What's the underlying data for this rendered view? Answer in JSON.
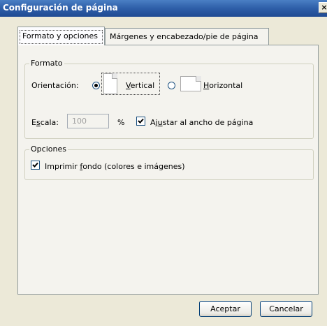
{
  "window": {
    "title": "Configuración de página",
    "close_glyph": "×"
  },
  "tabs": [
    {
      "label": "Formato y opciones",
      "active": true
    },
    {
      "label": "Márgenes y encabezado/pie de página",
      "active": false
    }
  ],
  "format_group": {
    "legend": "Formato",
    "orientation_label": "Orientación:",
    "orientation_options": [
      {
        "mnemonic": "V",
        "rest": "ertical",
        "selected": true
      },
      {
        "mnemonic": "H",
        "rest": "orizontal",
        "selected": false
      }
    ],
    "scale": {
      "label_pre": "E",
      "label_mnemonic": "s",
      "label_post": "cala:",
      "value": "100",
      "unit": "%"
    },
    "fit_width": {
      "checked": true,
      "pre": "Aj",
      "mnemonic": "u",
      "post": "star al ancho de página"
    }
  },
  "options_group": {
    "legend": "Opciones",
    "print_background": {
      "checked": true,
      "pre": "Imprimir ",
      "mnemonic": "f",
      "post": "ondo (colores e imágenes)"
    }
  },
  "buttons": {
    "accept": "Aceptar",
    "cancel": "Cancelar"
  }
}
